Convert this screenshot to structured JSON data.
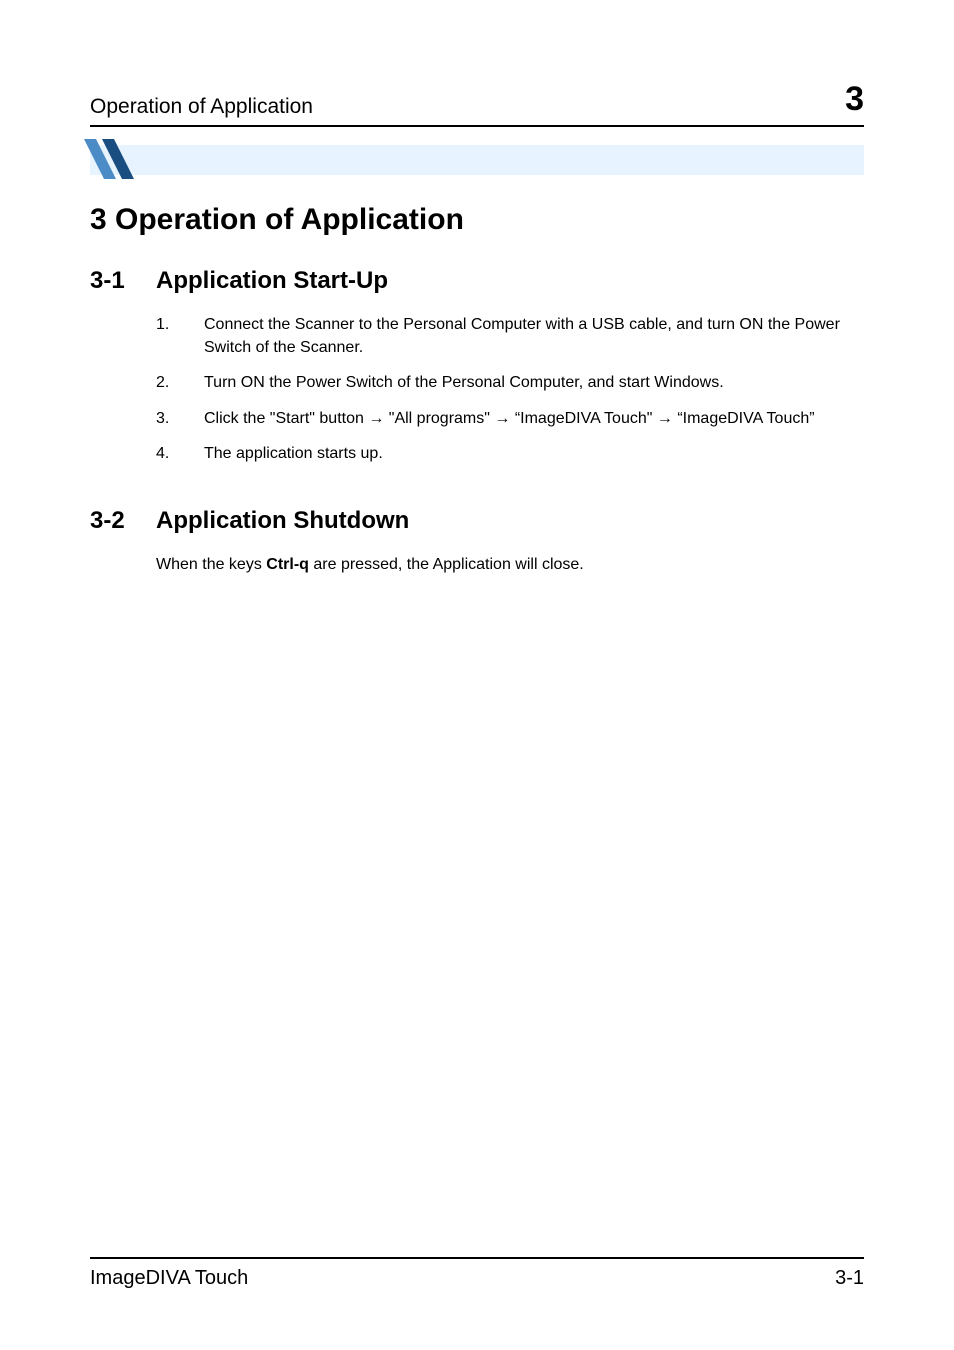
{
  "header": {
    "running_title": "Operation of Application",
    "chapter_number": "3"
  },
  "chapter": {
    "title": "3  Operation of Application"
  },
  "sections": [
    {
      "number": "3-1",
      "title": "Application Start-Up",
      "steps": [
        {
          "num": "1.",
          "text": "Connect the Scanner to the Personal Computer with a USB cable, and turn ON the Power Switch of the Scanner."
        },
        {
          "num": "2.",
          "text": "Turn ON the Power Switch of the Personal Computer, and start Windows."
        },
        {
          "num": "3.",
          "text": "Click the \"Start\" button → \"All programs\" → “ImageDIVA Touch\" → “ImageDIVA Touch”"
        },
        {
          "num": "4.",
          "text": "The application starts up."
        }
      ]
    },
    {
      "number": "3-2",
      "title": "Application Shutdown",
      "body_pre": "When the keys ",
      "body_bold": "Ctrl-q",
      "body_post": " are pressed, the Application will close."
    }
  ],
  "footer": {
    "left": "ImageDIVA Touch",
    "right": "3-1"
  }
}
